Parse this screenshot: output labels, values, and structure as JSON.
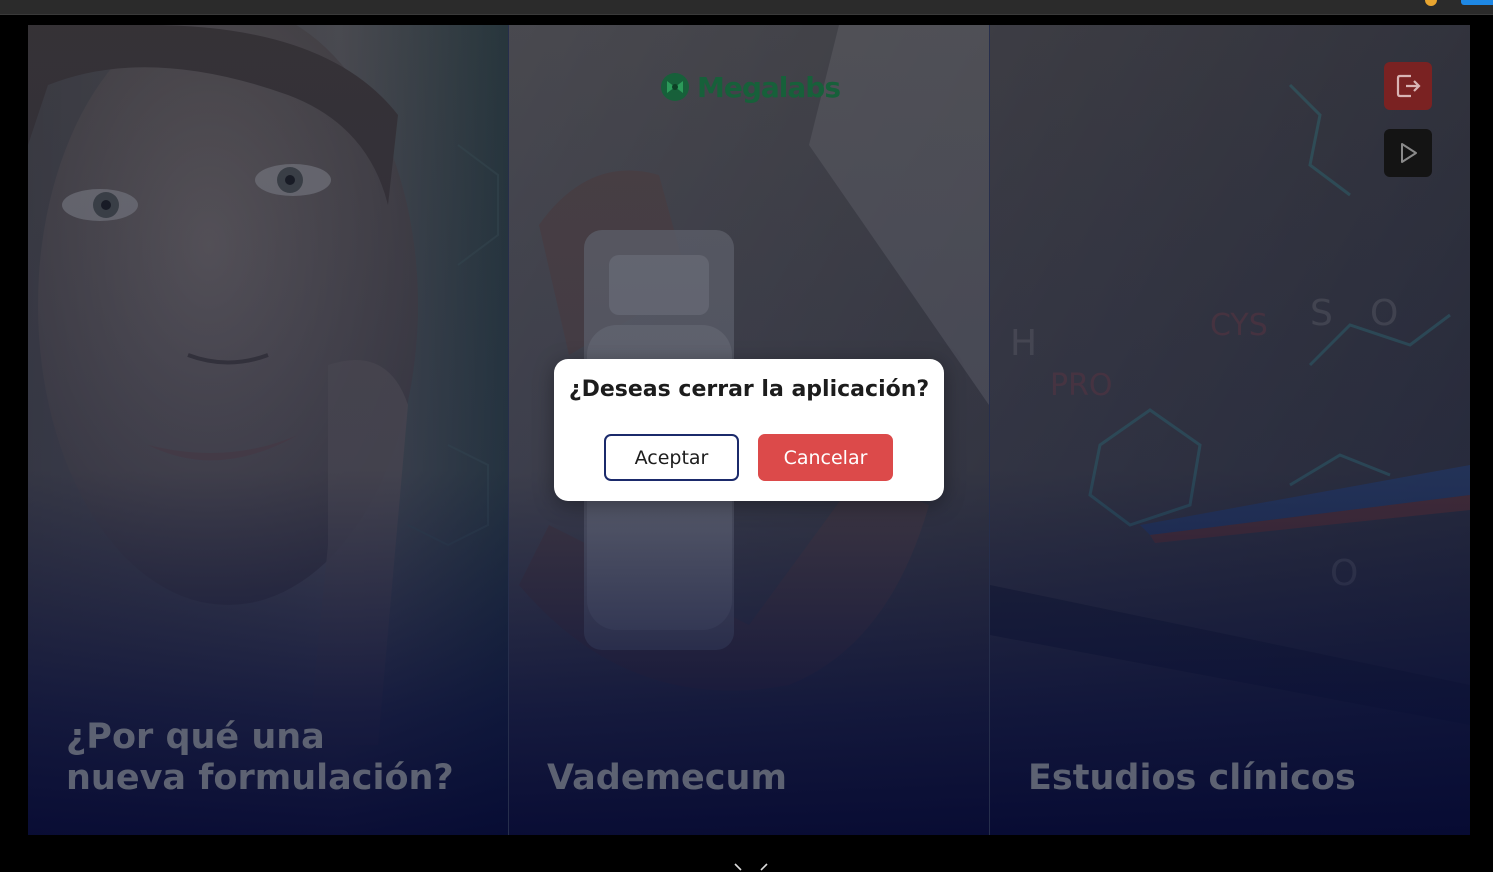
{
  "brand": {
    "name": "Megalabs",
    "color": "#17603a"
  },
  "panels": [
    {
      "title": "¿Por qué una\nnueva formulación?"
    },
    {
      "title": "Vademecum"
    },
    {
      "title": "Estudios clínicos"
    }
  ],
  "actions": {
    "exit_icon": "exit-icon",
    "play_icon": "play-icon"
  },
  "dialog": {
    "question": "¿Deseas cerrar la aplicación?",
    "accept_label": "Aceptar",
    "cancel_label": "Cancelar",
    "accept_border": "#1b2a6b",
    "cancel_color": "#dc4a4a"
  },
  "footer": {
    "nav_icon": "chevron-icon"
  }
}
